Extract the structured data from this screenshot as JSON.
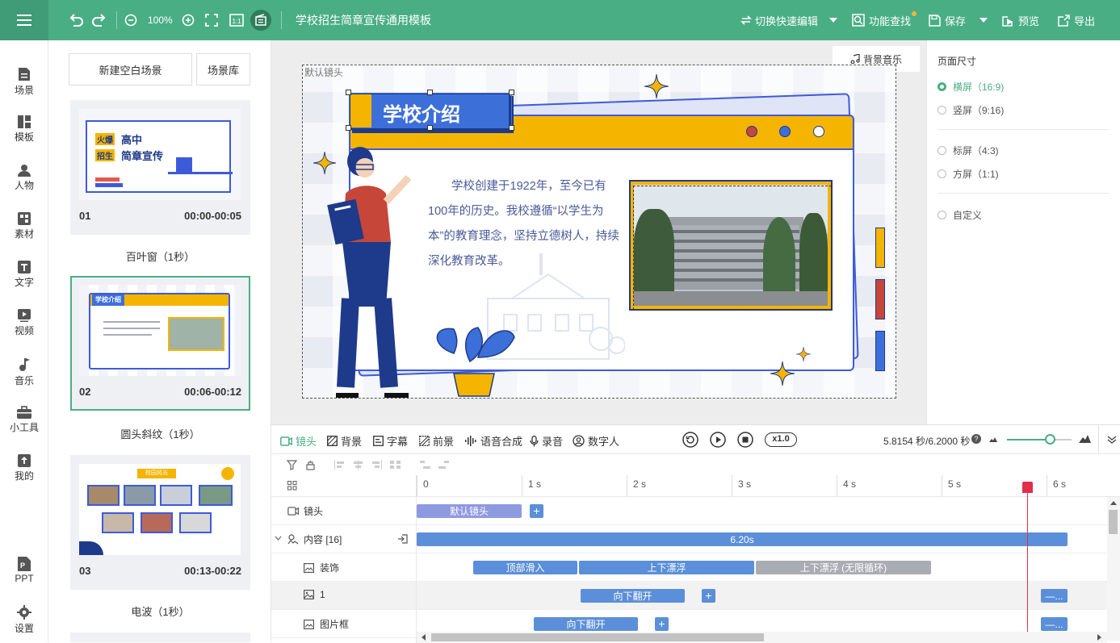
{
  "topbar": {
    "zoom": "100%",
    "doc_title": "学校招生简章宣传通用模板",
    "switch_edit": "切换快速编辑",
    "find": "功能查找",
    "save": "保存",
    "preview": "预览",
    "export": "导出"
  },
  "nav": [
    {
      "label": "场景",
      "icon": "scene-icon"
    },
    {
      "label": "模板",
      "icon": "template-icon"
    },
    {
      "label": "人物",
      "icon": "person-icon"
    },
    {
      "label": "素材",
      "icon": "material-icon"
    },
    {
      "label": "文字",
      "icon": "text-icon"
    },
    {
      "label": "视频",
      "icon": "video-icon"
    },
    {
      "label": "音乐",
      "icon": "music-icon"
    },
    {
      "label": "小工具",
      "icon": "toolbox-icon"
    },
    {
      "label": "我的",
      "icon": "upload-icon"
    },
    {
      "label": "PPT",
      "icon": "ppt-icon"
    },
    {
      "label": "设置",
      "icon": "gear-icon"
    }
  ],
  "scenes": {
    "new_blank": "新建空白场景",
    "library": "场景库",
    "items": [
      {
        "num": "01",
        "time": "00:00-00:05",
        "transition": "百叶窗（1秒）"
      },
      {
        "num": "02",
        "time": "00:06-00:12",
        "transition": "圆头斜纹（1秒）"
      },
      {
        "num": "03",
        "time": "00:13-00:22",
        "transition": "电波（1秒）"
      }
    ],
    "thumb1": {
      "badge1": "火爆",
      "title1": "高中",
      "badge2": "招生",
      "title2": "简章宣传"
    },
    "thumb2": {
      "title": "学校介绍"
    },
    "thumb3": {
      "title": "校园风光"
    }
  },
  "canvas": {
    "default_lens": "默认镜头",
    "bg_music": "背景音乐",
    "slide_title": "学校介绍",
    "slide_text": "学校创建于1922年，至今已有100年的历史。我校遵循“以学生为本”的教育理念，坚持立德树人，持续深化教育改革。"
  },
  "page_size": {
    "title": "页面尺寸",
    "options": [
      {
        "label": "横屏（16:9)",
        "selected": true
      },
      {
        "label": "竖屏（9:16)",
        "selected": false
      },
      {
        "label": "标屏（4:3)",
        "selected": false
      },
      {
        "label": "方屏（1:1)",
        "selected": false
      },
      {
        "label": "自定义",
        "selected": false
      }
    ]
  },
  "timeline": {
    "tabs": [
      "镜头",
      "背景",
      "字幕",
      "前景",
      "语音合成",
      "录音",
      "数字人"
    ],
    "speed": "x1.0",
    "time_readout": "5.8154 秒/6.2000 秒",
    "ticks": [
      "0",
      "1 s",
      "2 s",
      "3 s",
      "4 s",
      "5 s",
      "6 s"
    ],
    "playhead_seconds": 5.8154,
    "total_seconds": 6.2,
    "tracks": [
      {
        "label": "镜头",
        "bars": [
          {
            "text": "默认镜头",
            "color": "purple"
          }
        ]
      },
      {
        "label": "内容 [16]",
        "bars": [
          {
            "text": "6.20s",
            "color": "blue"
          }
        ]
      },
      {
        "label": "装饰",
        "bars": [
          {
            "text": "顶部滑入"
          },
          {
            "text": "上下漂浮"
          },
          {
            "text": "上下漂浮 (无限循环)"
          }
        ]
      },
      {
        "label": "1",
        "bars": [
          {
            "text": "向下翻开"
          },
          {
            "text": "—..."
          }
        ]
      },
      {
        "label": "图片框",
        "bars": [
          {
            "text": "向下翻开"
          },
          {
            "text": "—..."
          }
        ]
      }
    ]
  },
  "colors": {
    "accent": "#4aae85",
    "bar_blue": "#5b8fd9",
    "bar_purple": "#8e9ae0",
    "playhead": "#e0304a"
  }
}
